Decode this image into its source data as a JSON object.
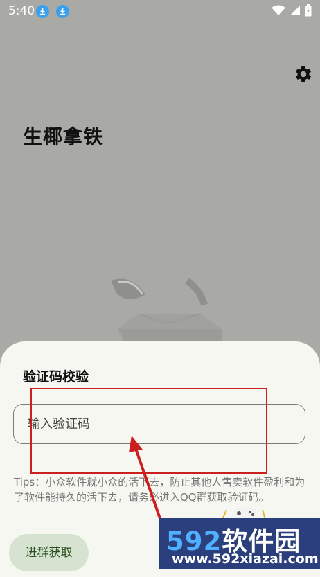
{
  "status_bar": {
    "time": "5:40",
    "icons": [
      "download-icon",
      "download-icon",
      "wifi-icon",
      "signal-icon",
      "battery-charging-icon"
    ]
  },
  "header": {
    "settings_icon": "gear-icon"
  },
  "app": {
    "title": "生椰拿铁"
  },
  "dialog": {
    "title": "验证码校验",
    "input_placeholder": "输入验证码",
    "input_value": "",
    "tips": "Tips：小众软件就小众的活下去，防止其他人售卖软件盈利和为了软件能持久的活下去，请务必进入QQ群获取验证码。",
    "join_button_label": "进群获取"
  },
  "watermark": {
    "brand_number": "592",
    "brand_text": "软件园",
    "url": "www.592xiazai.com"
  },
  "colors": {
    "background_dimmed": "#a9a9a5",
    "sheet": "#f7f7f2",
    "join_button_bg": "#d6e3d0",
    "annotation_red": "#cc1f1f",
    "watermark_bg": "#2b3f7c"
  }
}
